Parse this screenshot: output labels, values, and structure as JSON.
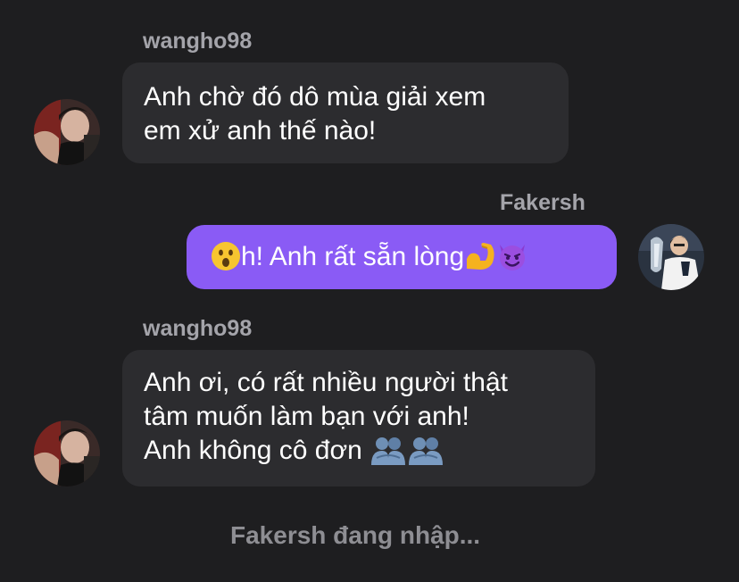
{
  "messages": [
    {
      "sender": "wangho98",
      "direction": "incoming",
      "lines": [
        "Anh chờ đó dô mùa giải xem",
        "em xử anh thế nào!"
      ]
    },
    {
      "sender": "Fakersh",
      "direction": "outgoing",
      "text": "h! Anh rất sẵn lòng",
      "emojis": [
        "surprised-face-icon",
        "flexed-biceps-icon",
        "smiling-devil-icon"
      ]
    },
    {
      "sender": "wangho98",
      "direction": "incoming",
      "lines": [
        "Anh ơi, có rất nhiều người thật",
        "tâm muốn làm bạn với anh!",
        "Anh không cô đơn"
      ],
      "emojis": [
        "people-hugging-icon",
        "people-hugging-icon"
      ]
    }
  ],
  "typing_indicator": "Fakersh đang nhập...",
  "colors": {
    "background": "#1e1e20",
    "incoming_bubble": "#2c2c2f",
    "outgoing_bubble": "#8a5bf5",
    "username": "#a4a4aa",
    "typing": "#8e8e93"
  }
}
